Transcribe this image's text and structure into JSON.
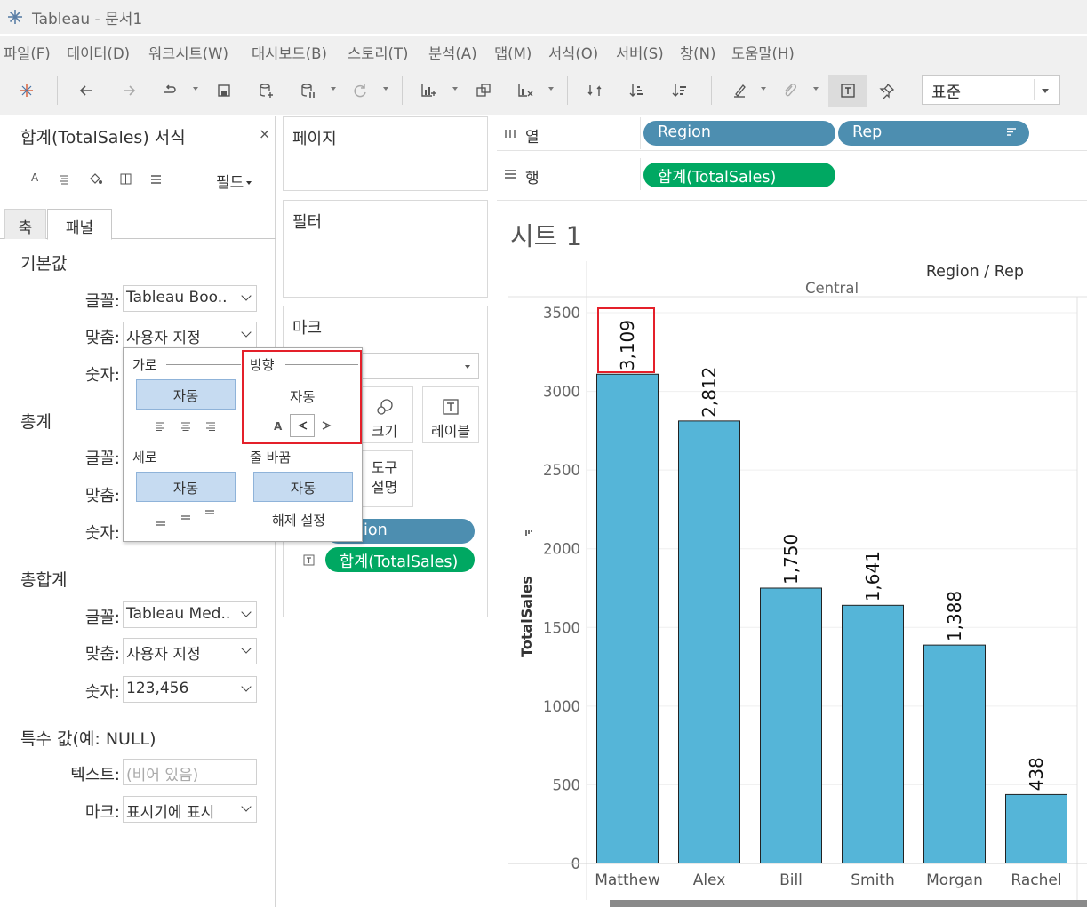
{
  "window": {
    "title": "Tableau - 문서1"
  },
  "menu": [
    "파일(F)",
    "데이터(D)",
    "워크시트(W)",
    "대시보드(B)",
    "스토리(T)",
    "분석(A)",
    "맵(M)",
    "서식(O)",
    "서버(S)",
    "창(N)",
    "도움말(H)"
  ],
  "toolbar": {
    "fit_select": "표준"
  },
  "format_panel": {
    "title": "합계(TotalSales) 서식",
    "close": "×",
    "fields_button": "필드",
    "tabs": [
      "축",
      "패널"
    ],
    "sections": {
      "default": "기본값",
      "totals": "총계",
      "grand_totals": "총합계",
      "special": "특수 값(예: NULL)"
    },
    "labels": {
      "font": "글꼴:",
      "align": "맞춤:",
      "numbers": "숫자:",
      "text": "텍스트:",
      "marks": "마크:"
    },
    "default_font": "Tableau Boo..",
    "default_align": "사용자 지정",
    "grand_font": "Tableau Med..",
    "grand_align": "사용자 지정",
    "grand_numbers": "123,456",
    "special_text_placeholder": "(비어 있음)",
    "special_marks": "표시기에 표시"
  },
  "cards": {
    "pages": "페이지",
    "filters": "필터",
    "marks": "마크",
    "size": "크기",
    "label": "레이블",
    "tooltip_line1": "도구",
    "tooltip_line2": "설명",
    "pill_region": "ion",
    "pill_sales": "합계(TotalSales)"
  },
  "shelves": {
    "columns_label": "열",
    "rows_label": "행",
    "col_pills": [
      "Region",
      "Rep"
    ],
    "row_pill": "합계(TotalSales)"
  },
  "sheet": {
    "title": "시트 1"
  },
  "align_popup": {
    "horizontal": "가로",
    "direction": "방향",
    "vertical": "세로",
    "wrap": "줄 바꿈",
    "auto": "자동",
    "unset": "해제 설정",
    "dir_letter": "A"
  },
  "colors": {
    "bar": "#55b5d8",
    "pill_blue": "#4d8eb0",
    "pill_green": "#00a862",
    "highlight": "#e4202a"
  },
  "chart_data": {
    "type": "bar",
    "title": "Region / Rep",
    "header": "Central",
    "categories": [
      "Matthew",
      "Alex",
      "Bill",
      "Smith",
      "Morgan",
      "Rachel"
    ],
    "values": [
      3109,
      2812,
      1750,
      1641,
      1388,
      438
    ],
    "labels": [
      "3,109",
      "2,812",
      "1,750",
      "1,641",
      "1,388",
      "438"
    ],
    "ylabel": "TotalSales",
    "ylim": [
      0,
      3500
    ],
    "yticks": [
      0,
      500,
      1000,
      1500,
      2000,
      2500,
      3000,
      3500
    ],
    "grid": true
  }
}
